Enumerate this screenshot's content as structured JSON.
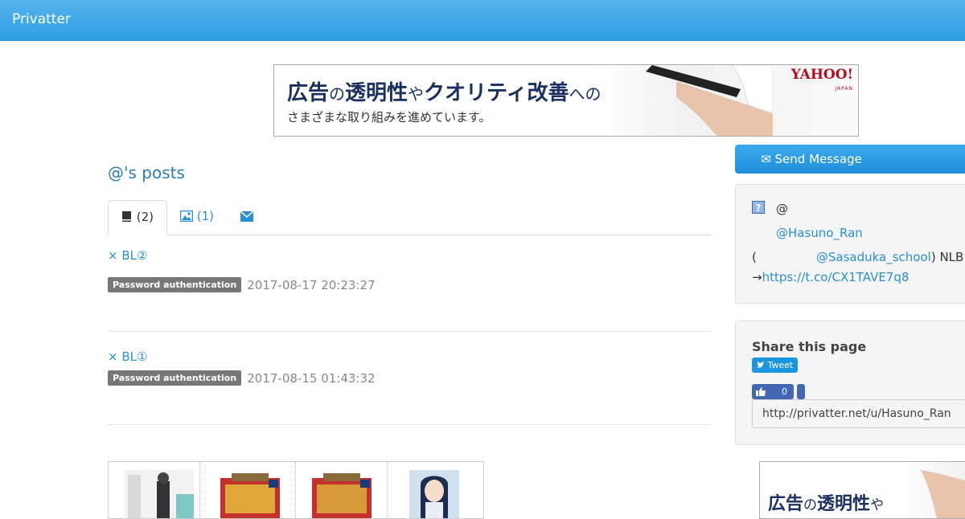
{
  "header": {
    "brand": "Privatter"
  },
  "ad_top": {
    "headline_parts": [
      "広告",
      "の",
      "透明性",
      "や",
      "クオリティ改善",
      "への"
    ],
    "subline": "さまざまな取り組みを進めています。",
    "logo": "YAHOO!",
    "logo_sub": "JAPAN"
  },
  "page_title": "@'s posts",
  "tabs": [
    {
      "icon": "book-icon",
      "label": "(2)",
      "active": true
    },
    {
      "icon": "image-icon",
      "label": "(1)",
      "active": false
    },
    {
      "icon": "envelope-icon",
      "label": "",
      "active": false
    }
  ],
  "posts": [
    {
      "title": "× BL②",
      "badge": "Password authentication",
      "date": "2017-08-17 20:23:27"
    },
    {
      "title": "× BL①",
      "badge": "Password authentication",
      "date": "2017-08-15 01:43:32"
    }
  ],
  "sidebar": {
    "send_message": "✉ Send Message",
    "profile": {
      "at": "@",
      "handle": "@Hasuno_Ran",
      "line3_open": "(",
      "school_handle": "@Sasaduka_school",
      "line3_close": ") NLB",
      "arrow": "→",
      "link": "https://t.co/CX1TAVE7q8"
    },
    "share": {
      "title": "Share this page",
      "tweet": "Tweet",
      "like_count": "0",
      "url": "http://privatter.net/u/Hasuno_Ran"
    }
  },
  "ad_side": {
    "headline_parts": [
      "広告",
      "の",
      "透明性",
      "や"
    ]
  }
}
